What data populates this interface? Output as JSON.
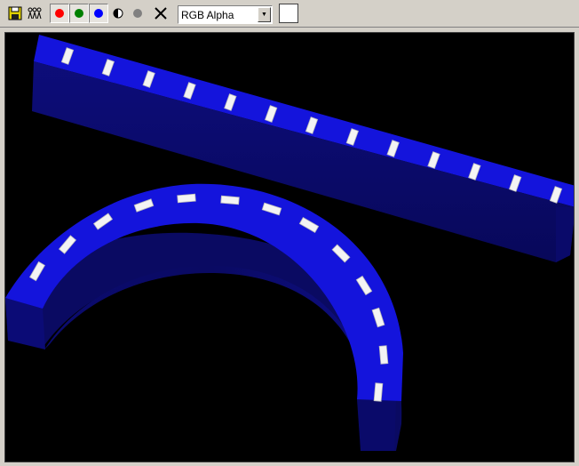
{
  "toolbar": {
    "save_icon": "floppy-disk-icon",
    "people_icon": "people-icon",
    "channels": [
      {
        "name": "red",
        "color": "#ff0000"
      },
      {
        "name": "green",
        "color": "#008000"
      },
      {
        "name": "blue",
        "color": "#0000ff"
      }
    ],
    "mono_icon": "half-circle-icon",
    "gray_icon": "gray-dot-icon",
    "clear_icon": "x-icon",
    "channel_mode": "RGB Alpha",
    "swatch_color": "#ffffff"
  },
  "viewport": {
    "background": "#000000",
    "object_color": "#1010d8"
  }
}
